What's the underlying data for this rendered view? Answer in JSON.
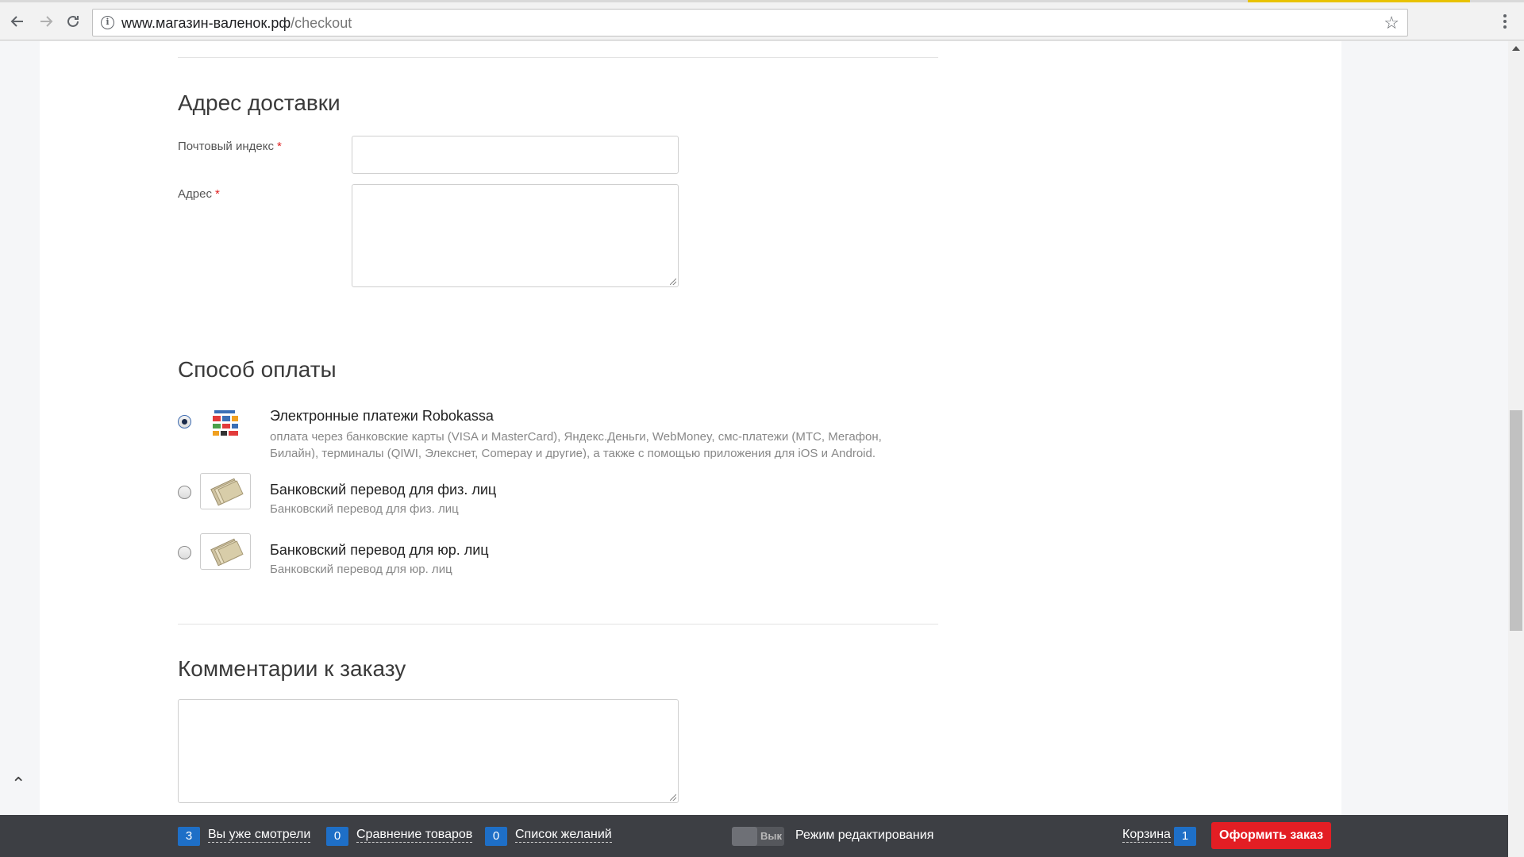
{
  "browser": {
    "url_host": "www.магазин-валенок.рф",
    "url_path": "/checkout",
    "back_icon": "arrow-left-icon",
    "forward_icon": "arrow-right-icon",
    "reload_icon": "reload-icon",
    "info_icon": "info-icon",
    "bookmark_icon": "star-icon"
  },
  "delivery": {
    "title": "Адрес доставки",
    "postal_label": "Почтовый индекс",
    "address_label": "Адрес",
    "postal_value": "",
    "address_value": "",
    "required_mark": "*"
  },
  "payment": {
    "title": "Способ оплаты",
    "methods": [
      {
        "name": "Электронные платежи Robokassa",
        "description": "оплата через банковские карты (VISA и MasterCard), Яндекс.Деньги, WebMoney, смс-платежи (МТС, Мегафон, Билайн), терминалы (QIWI, Элекснет, Comepay и другие), а также с помощью приложения для iOS и Android.",
        "selected": true
      },
      {
        "name": "Банковский перевод для физ. лиц",
        "description": "Банковский перевод для физ. лиц",
        "selected": false
      },
      {
        "name": "Банковский перевод для юр. лиц",
        "description": "Банковский перевод для юр. лиц",
        "selected": false
      }
    ]
  },
  "comments": {
    "title": "Комментарии к заказу",
    "value": ""
  },
  "bottom_bar": {
    "viewed_count": "3",
    "viewed_label": "Вы уже смотрели",
    "compare_count": "0",
    "compare_label": "Сравнение товаров",
    "wishlist_count": "0",
    "wishlist_label": "Список желаний",
    "toggle_state": "Вык",
    "edit_mode_label": "Режим редактирования",
    "cart_label": "Корзина",
    "cart_count": "1",
    "checkout_button": "Оформить заказ"
  },
  "colors": {
    "accent_blue": "#1e6fc7",
    "order_red": "#e31e24",
    "bar_bg": "#3d3f44"
  }
}
